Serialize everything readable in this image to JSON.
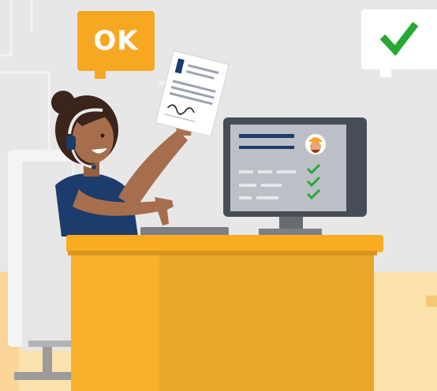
{
  "ok_bubble": {
    "text": "OK",
    "color": "#f7a823"
  },
  "check_bubble": {
    "icon": "check-icon",
    "check_color": "#27a833"
  },
  "colors": {
    "background": "#e7e7e8",
    "floor": "#fbe1ab",
    "desk_top": "#f9ac20",
    "desk_front": "#e8a72a",
    "monitor_frame": "#474d57",
    "shirt": "#1b3c6c",
    "skin": "#a76e4d",
    "hair": "#3a241b"
  }
}
